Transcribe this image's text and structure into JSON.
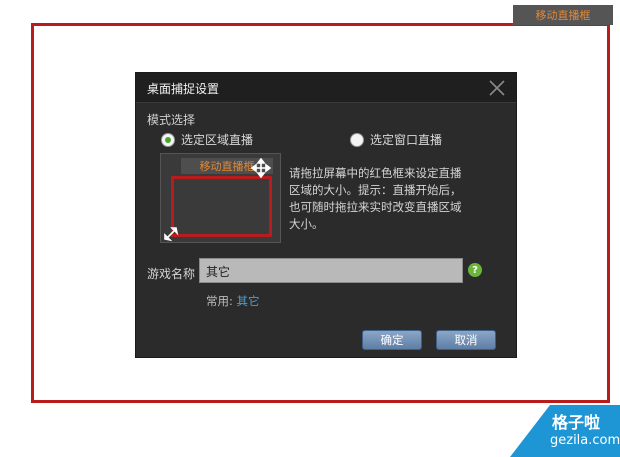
{
  "outer_frame": {
    "tab_label": "移动直播框"
  },
  "dialog": {
    "title": "桌面捕捉设置",
    "mode_label": "模式选择",
    "radio_area": "选定区域直播",
    "radio_window": "选定窗口直播",
    "preview_tab": "移动直播框",
    "hint": "请拖拉屏幕中的红色框来设定直播区域的大小。提示：直播开始后，也可随时拖拉来实时改变直播区域大小。",
    "game_name_label": "游戏名称",
    "game_name_value": "其它",
    "common_label": "常用:",
    "common_value": "其它",
    "ok_label": "确定",
    "cancel_label": "取消"
  },
  "watermark": {
    "cn": "格子啦",
    "en": "gezila.com"
  },
  "colors": {
    "frame_red": "#b91c1c",
    "tab_orange": "#e0893a",
    "dialog_bg": "#2b2b2b",
    "link_blue": "#4a9fd8",
    "watermark_blue": "#1e96d6"
  },
  "icons": [
    "close-icon",
    "move-icon",
    "resize-icon",
    "help-icon"
  ]
}
